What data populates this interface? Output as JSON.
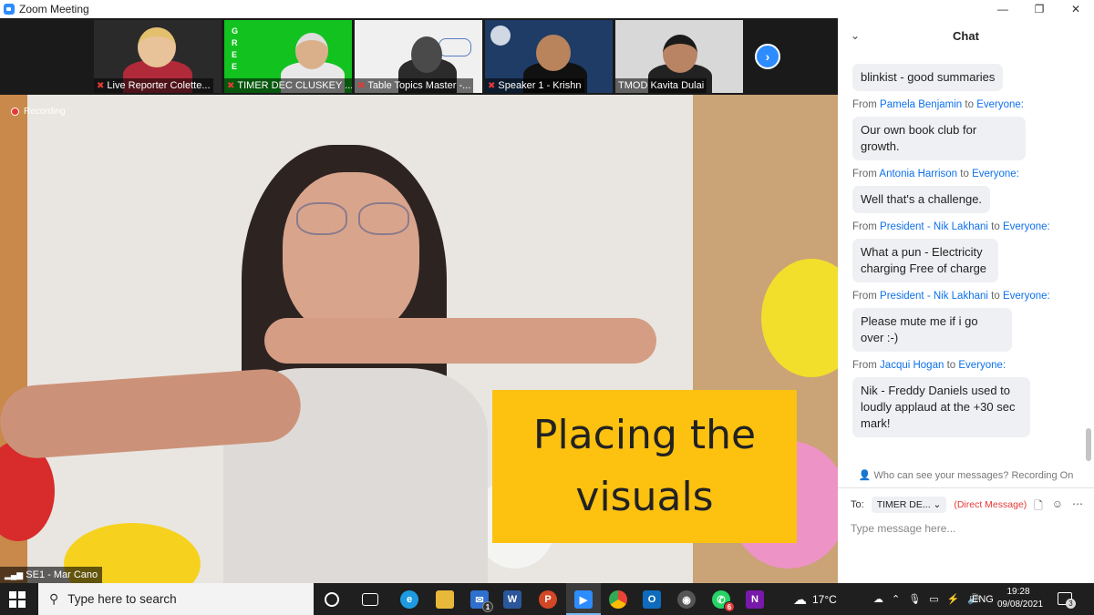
{
  "window": {
    "title": "Zoom Meeting",
    "controls": {
      "minimize": "—",
      "maximize": "❐",
      "close": "✕"
    }
  },
  "thumbnails": [
    {
      "label": "Live Reporter Colette...",
      "muted": true
    },
    {
      "label": "TIMER DEC CLUSKEY ...",
      "muted": true,
      "background_text": [
        "G",
        "R",
        "E",
        "E"
      ]
    },
    {
      "label": "Table Topics Master -...",
      "muted": true
    },
    {
      "label": "Speaker 1 - Krishn",
      "muted": true
    },
    {
      "label": "TMOD Kavita Dulai",
      "muted": false
    }
  ],
  "main_video": {
    "recording_label": "Recording",
    "speaker_label": "SE1 - Mar Cano",
    "caption_lines": [
      "Placing the",
      "visuals"
    ]
  },
  "chat": {
    "title": "Chat",
    "messages": [
      {
        "from": "",
        "to": "",
        "text": "blinkist - good summaries"
      },
      {
        "from": "Pamela Benjamin",
        "to": "Everyone:",
        "text": "Our own book club for growth."
      },
      {
        "from": "Antonia Harrison",
        "to": "Everyone:",
        "text": "Well that's a challenge."
      },
      {
        "from": "President - Nik Lakhani",
        "to": "Everyone:",
        "text": "What a pun - Electricity charging Free of charge"
      },
      {
        "from": "President - Nik Lakhani",
        "to": "Everyone:",
        "text": "Please mute me if i go over :-)"
      },
      {
        "from": "Jacqui Hogan",
        "to": "Everyone:",
        "text": "Nik - Freddy Daniels used to loudly applaud at the +30 sec mark!"
      }
    ],
    "from_prefix": "From",
    "to_word": "to",
    "visibility_note": "Who can see your messages? Recording On",
    "to_label": "To:",
    "recipient": "TIMER DE...",
    "direct_label": "(Direct Message)",
    "input_placeholder": "Type message here..."
  },
  "taskbar": {
    "search_placeholder": "Type here to search",
    "weather": "17°C",
    "language": "ENG",
    "time": "19:28",
    "date": "09/08/2021",
    "notification_count": "3",
    "mail_badge": "1",
    "whatsapp_badge": "6"
  },
  "colors": {
    "zoom_blue": "#2d8cff",
    "chat_link": "#0e71eb",
    "direct_red": "#e53935",
    "caption_yellow": "#fdc110",
    "taskbar": "#1f1f1f"
  }
}
